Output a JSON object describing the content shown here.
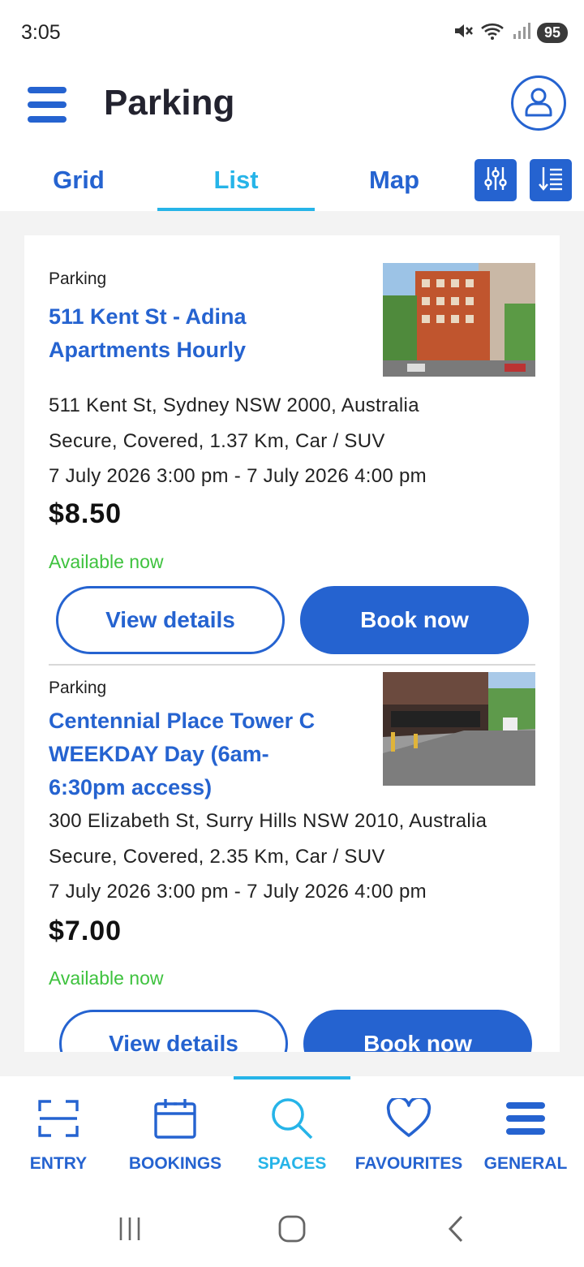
{
  "status_bar": {
    "time": "3:05",
    "battery": "95"
  },
  "app_bar": {
    "title": "Parking"
  },
  "tabs": [
    {
      "label": "Grid"
    },
    {
      "label": "List"
    },
    {
      "label": "Map"
    }
  ],
  "active_tab": "List",
  "listings": [
    {
      "type": "Parking",
      "title": "511 Kent St - Adina Apartments Hourly",
      "address": "511 Kent St, Sydney NSW 2000, Australia",
      "features": "Secure, Covered, 1.37 Km, Car / SUV",
      "timeslot": "7 July 2026 3:00 pm - 7 July 2026 4:00 pm",
      "price": "$8.50",
      "availability": "Available now",
      "details_label": "View details",
      "book_label": "Book now"
    },
    {
      "type": "Parking",
      "title": "Centennial Place Tower C WEEKDAY Day (6am-6:30pm access)",
      "address": "300 Elizabeth St, Surry Hills NSW 2010, Australia",
      "features": "Secure, Covered, 2.35 Km, Car / SUV",
      "timeslot": "7 July 2026 3:00 pm - 7 July 2026 4:00 pm",
      "price": "$7.00",
      "availability": "Available now",
      "details_label": "View details",
      "book_label": "Book now"
    }
  ],
  "bottom_nav": [
    {
      "label": "ENTRY",
      "icon": "scan-icon"
    },
    {
      "label": "BOOKINGS",
      "icon": "calendar-icon"
    },
    {
      "label": "SPACES",
      "icon": "search-icon"
    },
    {
      "label": "FAVOURITES",
      "icon": "heart-icon"
    },
    {
      "label": "GENERAL",
      "icon": "menu-icon"
    }
  ],
  "active_nav": "SPACES",
  "colors": {
    "primary": "#2563d0",
    "accent": "#26b4e8",
    "available": "#3ec23e",
    "background": "#f3f3f3"
  }
}
